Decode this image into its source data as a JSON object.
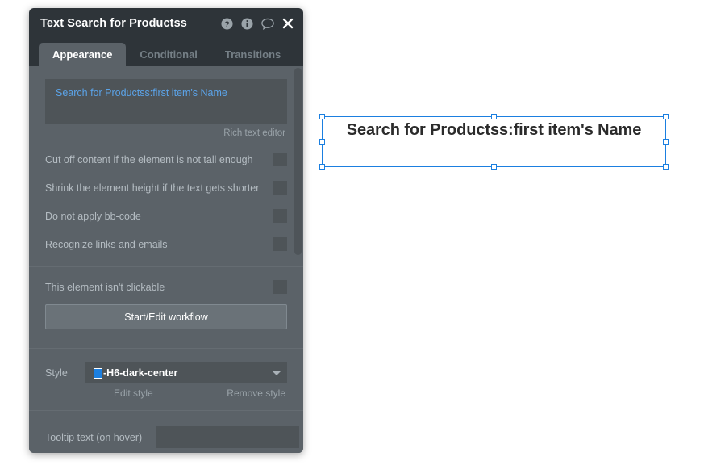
{
  "canvas": {
    "element": {
      "name": "text-element",
      "text": "Search for Productss:first item's Name",
      "selected": true,
      "handles": [
        "top-left",
        "top-center",
        "top-right",
        "middle-left",
        "middle-right",
        "bottom-left",
        "bottom-center",
        "bottom-right"
      ]
    }
  },
  "panel": {
    "title": "Text Search for Productss",
    "header_icons": [
      {
        "name": "help-icon",
        "glyph": "?"
      },
      {
        "name": "info-icon",
        "glyph": "i"
      },
      {
        "name": "comment-icon",
        "glyph": "speech-bubble"
      },
      {
        "name": "close-icon",
        "glyph": "✕"
      }
    ],
    "tabs": [
      {
        "label": "Appearance",
        "active": true
      },
      {
        "label": "Conditional",
        "active": false
      },
      {
        "label": "Transitions",
        "active": false
      }
    ],
    "rich_text": {
      "value": "Search for Productss:first item's Name",
      "caption": "Rich text editor"
    },
    "checkboxes": [
      {
        "label": "Cut off content if the element is not tall enough",
        "checked": false
      },
      {
        "label": "Shrink the element height if the text gets shorter",
        "checked": false
      },
      {
        "label": "Do not apply bb-code",
        "checked": false
      },
      {
        "label": "Recognize links and emails",
        "checked": false
      }
    ],
    "clickable": {
      "label": "This element isn't clickable",
      "checked": false,
      "workflow_button": "Start/Edit workflow"
    },
    "style": {
      "label": "Style",
      "value": "-H6-dark-center",
      "swatch_color": "#1b7fe0",
      "edit_link": "Edit style",
      "remove_link": "Remove style"
    },
    "tooltip": {
      "label": "Tooltip text (on hover)",
      "value": "",
      "placeholder": ""
    }
  },
  "colors": {
    "panel_bg": "#5b6268",
    "header_bg": "#2e3439",
    "field_bg": "#4e5458",
    "accent_blue": "#1b7fe0",
    "link_blue": "#5ba3e8",
    "label_text": "#b4bcc2",
    "muted_text": "#9aa3a9"
  }
}
